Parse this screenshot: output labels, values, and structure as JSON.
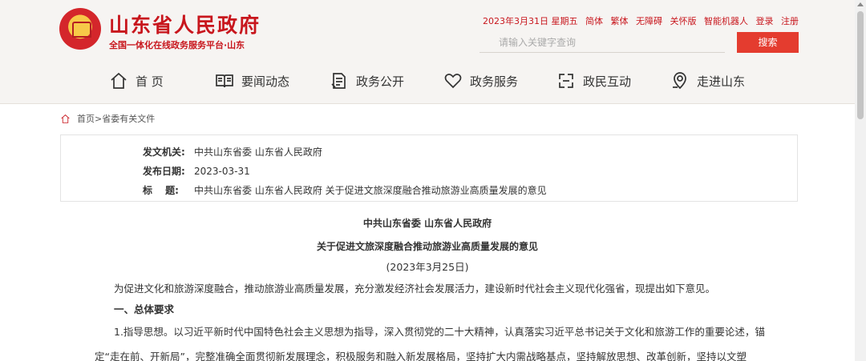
{
  "header": {
    "title": "山东省人民政府",
    "subtitle": "全国一体化在线政务服务平台·山东",
    "date": "2023年3月31日 星期五",
    "links": [
      "简体",
      "繁体",
      "无障碍",
      "关怀版",
      "智能机器人",
      "登录",
      "注册"
    ],
    "search_placeholder": "请输入关键字查询",
    "search_button": "搜索"
  },
  "nav": [
    {
      "label": "首 页",
      "icon": "home-icon"
    },
    {
      "label": "要闻动态",
      "icon": "book-icon"
    },
    {
      "label": "政务公开",
      "icon": "document-icon"
    },
    {
      "label": "政务服务",
      "icon": "heart-icon"
    },
    {
      "label": "政民互动",
      "icon": "interaction-icon"
    },
    {
      "label": "走进山东",
      "icon": "location-icon"
    }
  ],
  "breadcrumb": "首页>省委有关文件",
  "info": {
    "issuer_label": "发文机关:",
    "issuer": "中共山东省委 山东省人民政府",
    "date_label": "发布日期:",
    "date": "2023-03-31",
    "title_label": "标　 题:",
    "title": "中共山东省委 山东省人民政府 关于促进文旅深度融合推动旅游业高质量发展的意见"
  },
  "article": {
    "heading1": "中共山东省委 山东省人民政府",
    "heading2": "关于促进文旅深度融合推动旅游业高质量发展的意见",
    "date": "(2023年3月25日)",
    "intro": "为促进文化和旅游深度融合，推动旅游业高质量发展，充分激发经济社会发展活力，建设新时代社会主义现代化强省，现提出如下意见。",
    "section1": "一、总体要求",
    "p1": "1.指导思想。以习近平新时代中国特色社会主义思想为指导，深入贯彻党的二十大精神，认真落实习近平总书记关于文化和旅游工作的重要论述，锚",
    "p2": "定“走在前、开新局”，完整准确全面贯彻新发展理念，积极服务和融入新发展格局，坚持扩大内需战略基点，坚持解放思想、改革创新，坚持以文塑"
  }
}
